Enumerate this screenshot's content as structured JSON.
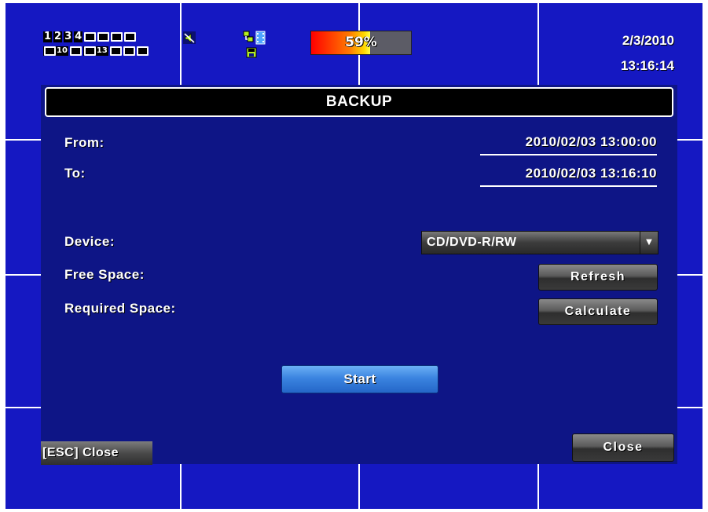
{
  "status_bar": {
    "channels_row1": [
      "1",
      "2",
      "3",
      "4"
    ],
    "channels_row2": [
      "10",
      "13"
    ],
    "hdd_usage": {
      "percent": 59,
      "label": "59%"
    },
    "date": "2/3/2010",
    "time": "13:16:14",
    "icons": [
      "speaker-muted-icon",
      "network-icon",
      "film-icon",
      "floppy-icon"
    ]
  },
  "dialog": {
    "title": "BACKUP",
    "from_label": "From:",
    "from_value": "2010/02/03 13:00:00",
    "to_label": "To:",
    "to_value": "2010/02/03 13:16:10",
    "device_label": "Device:",
    "device_value": "CD/DVD-R/RW",
    "free_space_label": "Free Space:",
    "required_space_label": "Required Space:",
    "refresh_label": "Refresh",
    "calculate_label": "Calculate",
    "start_label": "Start",
    "esc_hint": "[ESC] Close",
    "close_label": "Close"
  },
  "colors": {
    "background": "#1518c2",
    "dialog_bg": "#0e1586",
    "accent_button": "#3b84e0"
  }
}
